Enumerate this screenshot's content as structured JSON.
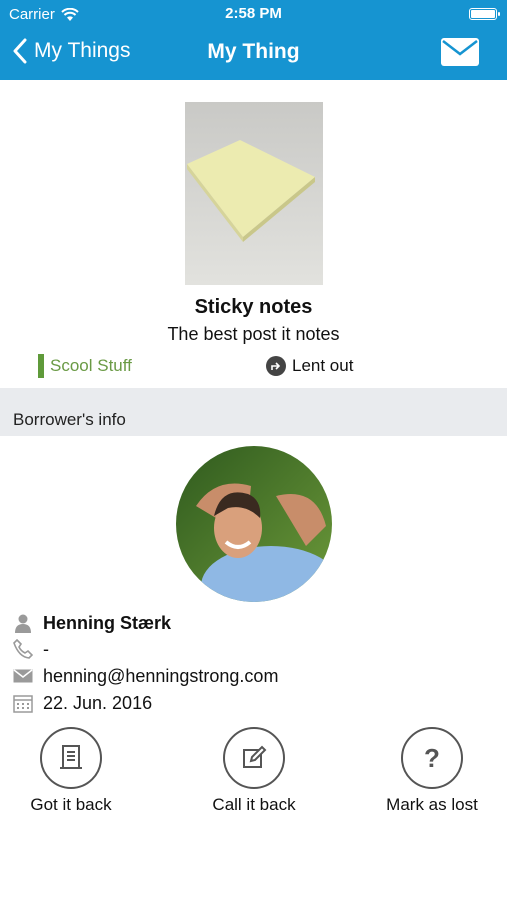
{
  "status_bar": {
    "carrier": "Carrier",
    "time": "2:58 PM"
  },
  "nav": {
    "back_label": "My Things",
    "title": "My Thing",
    "mail_icon": "mail-icon"
  },
  "item": {
    "name": "Sticky notes",
    "description": "The best post it notes",
    "category": "Scool Stuff",
    "category_color": "#5f9a3a",
    "status": "Lent out"
  },
  "section": {
    "label": "Borrower's info"
  },
  "borrower": {
    "name": "Henning Stærk",
    "phone": "-",
    "email": "henning@henningstrong.com",
    "date": "22. Jun. 2016"
  },
  "actions": [
    {
      "label": "Got it back",
      "icon": "receipt-icon"
    },
    {
      "label": "Call it back",
      "icon": "edit-icon"
    },
    {
      "label": "Mark as lost",
      "icon": "question-icon"
    }
  ],
  "colors": {
    "header": "#1694d1",
    "section_bg": "#e9ebee"
  }
}
